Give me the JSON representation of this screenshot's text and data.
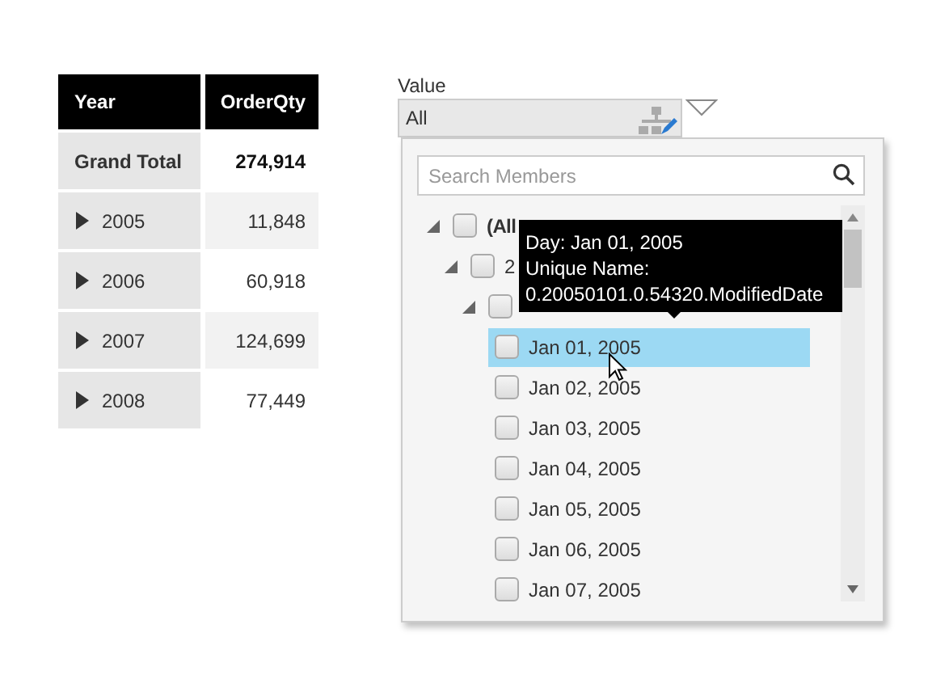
{
  "table": {
    "columns": [
      "Year",
      "OrderQty"
    ],
    "rows": [
      {
        "label": "Grand Total",
        "value": "274,914",
        "kind": "total"
      },
      {
        "label": "2005",
        "value": "11,848",
        "kind": "member",
        "expanded": false
      },
      {
        "label": "2006",
        "value": "60,918",
        "kind": "member",
        "expanded": false
      },
      {
        "label": "2007",
        "value": "124,699",
        "kind": "member",
        "expanded": false
      },
      {
        "label": "2008",
        "value": "77,449",
        "kind": "member",
        "expanded": false
      }
    ]
  },
  "filter": {
    "label": "Value",
    "value": "All",
    "open": true,
    "search": {
      "placeholder": "Search Members"
    },
    "tree": [
      {
        "label": "(All",
        "expanded": true,
        "checked": false,
        "selected": false,
        "children": [
          {
            "label": "2",
            "expanded": true,
            "checked": false,
            "selected": false,
            "children": [
              {
                "expanded": true,
                "checked": false,
                "selected": false,
                "children": [
                  {
                    "label": "Jan 01, 2005",
                    "checked": false,
                    "selected": true
                  },
                  {
                    "label": "Jan 02, 2005",
                    "checked": false,
                    "selected": false
                  },
                  {
                    "label": "Jan 03, 2005",
                    "checked": false,
                    "selected": false
                  },
                  {
                    "label": "Jan 04, 2005",
                    "checked": false,
                    "selected": false
                  },
                  {
                    "label": "Jan 05, 2005",
                    "checked": false,
                    "selected": false
                  },
                  {
                    "label": "Jan 06, 2005",
                    "checked": false,
                    "selected": false
                  },
                  {
                    "label": "Jan 07, 2005",
                    "checked": false,
                    "selected": false
                  }
                ]
              }
            ]
          }
        ]
      }
    ],
    "tooltip": [
      "Day: Jan 01, 2005",
      "Unique Name:",
      "0.20050101.0.54320.ModifiedDate"
    ]
  }
}
